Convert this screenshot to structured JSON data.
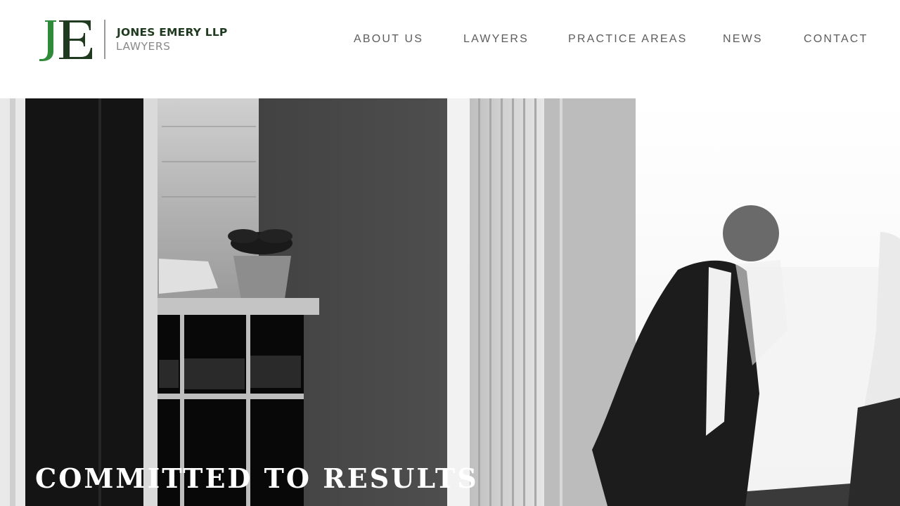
{
  "brand": {
    "monogram": "JE",
    "name": "JONES EMERY LLP",
    "tagline": "LAWYERS",
    "colors": {
      "green": "#2f8a3a",
      "dark_green": "#1f3a1f",
      "gray": "#8a8a8a"
    }
  },
  "nav": {
    "items": [
      {
        "label": "ABOUT US"
      },
      {
        "label": "LAWYERS"
      },
      {
        "label": "PRACTICE AREAS"
      },
      {
        "label": "NEWS"
      },
      {
        "label": "CONTACT"
      }
    ]
  },
  "hero": {
    "title": "COMMITTED TO RESULTS",
    "image": "black-and-white office photo"
  }
}
